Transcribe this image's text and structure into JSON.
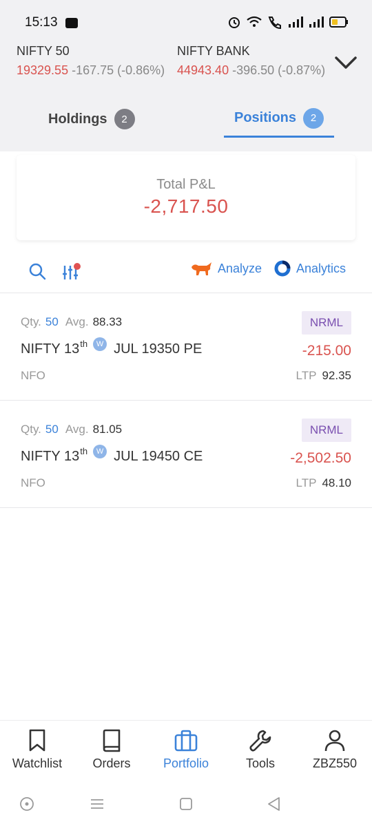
{
  "status_bar": {
    "time": "15:13",
    "icons": [
      "paytm-badge-icon",
      "alarm-icon",
      "wifi-icon",
      "volte-call-icon",
      "signal-icon",
      "signal-icon",
      "battery-icon"
    ]
  },
  "indices": [
    {
      "name": "NIFTY 50",
      "price": "19329.55",
      "change": "-167.75 (-0.86%)"
    },
    {
      "name": "NIFTY BANK",
      "price": "44943.40",
      "change": "-396.50 (-0.87%)"
    }
  ],
  "tabs": [
    {
      "label": "Holdings",
      "count": "2",
      "active": false
    },
    {
      "label": "Positions",
      "count": "2",
      "active": true
    }
  ],
  "summary": {
    "label": "Total P&L",
    "value": "-2,717.50"
  },
  "toolbar": {
    "analyze_label": "Analyze",
    "analytics_label": "Analytics"
  },
  "positions": [
    {
      "qty_label": "Qty.",
      "qty": "50",
      "avg_label": "Avg.",
      "avg": "88.33",
      "product": "NRML",
      "symbol_prefix": "NIFTY 13",
      "symbol_sup": "th",
      "weekly_badge": "W",
      "symbol_suffix": "JUL 19350 PE",
      "pnl": "-215.00",
      "exchange": "NFO",
      "ltp_label": "LTP",
      "ltp": "92.35"
    },
    {
      "qty_label": "Qty.",
      "qty": "50",
      "avg_label": "Avg.",
      "avg": "81.05",
      "product": "NRML",
      "symbol_prefix": "NIFTY 13",
      "symbol_sup": "th",
      "weekly_badge": "W",
      "symbol_suffix": "JUL 19450 CE",
      "pnl": "-2,502.50",
      "exchange": "NFO",
      "ltp_label": "LTP",
      "ltp": "48.10"
    }
  ],
  "bottom_nav": [
    {
      "label": "Watchlist",
      "icon": "bookmark-icon",
      "active": false
    },
    {
      "label": "Orders",
      "icon": "book-icon",
      "active": false
    },
    {
      "label": "Portfolio",
      "icon": "briefcase-icon",
      "active": true
    },
    {
      "label": "Tools",
      "icon": "wrench-icon",
      "active": false
    },
    {
      "label": "ZBZ550",
      "icon": "user-icon",
      "active": false
    }
  ],
  "colors": {
    "accent": "#3b82d9",
    "loss": "#d9534f",
    "product_badge": "#7a4fb0"
  }
}
